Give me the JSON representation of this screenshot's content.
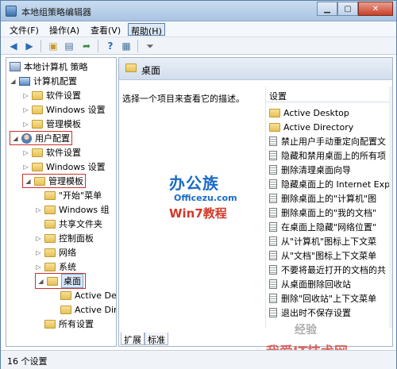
{
  "window": {
    "title": "本地组策略编辑器"
  },
  "menu": [
    "文件(F)",
    "操作(A)",
    "查看(V)",
    "帮助(H)"
  ],
  "tree": {
    "root": "本地计算机 策略",
    "computer_config": "计算机配置",
    "cc_children": [
      "软件设置",
      "Windows 设置",
      "管理模板"
    ],
    "user_config": "用户配置",
    "uc_children": [
      "软件设置",
      "Windows 设置"
    ],
    "admin_templates": "管理模板",
    "at_children": [
      "\"开始\"菜单",
      "Windows 组",
      "共享文件夹",
      "控制面板",
      "网络",
      "系统"
    ],
    "desktop": "桌面",
    "desktop_children": [
      "Active De",
      "Active Dir"
    ],
    "all_settings": "所有设置"
  },
  "right": {
    "header_title": "桌面",
    "description": "选择一个项目来查看它的描述。",
    "settings_header": "设置",
    "settings": [
      {
        "label": "Active Desktop",
        "icon": "folder"
      },
      {
        "label": "Active Directory",
        "icon": "folder"
      },
      {
        "label": "禁止用户手动重定向配置文",
        "icon": "doc"
      },
      {
        "label": "隐藏和禁用桌面上的所有项",
        "icon": "doc"
      },
      {
        "label": "删除清理桌面向导",
        "icon": "doc"
      },
      {
        "label": "隐藏桌面上的 Internet Exp",
        "icon": "doc"
      },
      {
        "label": "删除桌面上的\"计算机\"图",
        "icon": "doc"
      },
      {
        "label": "删除桌面上的\"我的文档\"",
        "icon": "doc"
      },
      {
        "label": "在桌面上隐藏\"网络位置\"",
        "icon": "doc"
      },
      {
        "label": "从\"计算机\"图标上下文菜",
        "icon": "doc"
      },
      {
        "label": "从\"文档\"图标上下文菜单",
        "icon": "doc"
      },
      {
        "label": "不要将最近打开的文档的共",
        "icon": "doc"
      },
      {
        "label": "从桌面删除回收站",
        "icon": "doc"
      },
      {
        "label": "删除\"回收站\"上下文菜单",
        "icon": "doc"
      },
      {
        "label": "退出时不保存设置",
        "icon": "doc"
      }
    ],
    "tabs": [
      "扩展",
      "标准"
    ]
  },
  "watermarks": {
    "logo": "办公族",
    "site": "Officezu.com",
    "win7": "Win7教程",
    "bottom": "我爱IT技术网",
    "exp": "经验"
  },
  "status": "16 个设置"
}
